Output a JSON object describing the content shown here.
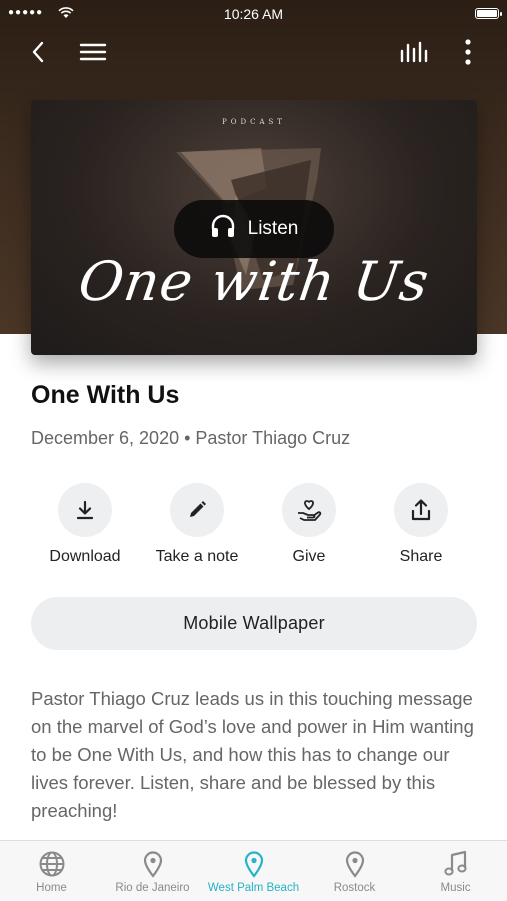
{
  "status_bar": {
    "time": "10:26 AM",
    "signal": "●●●●●"
  },
  "nav": {
    "back_icon": "back-chevron-icon",
    "menu_icon": "hamburger-menu-icon",
    "audio_icon": "audio-bars-icon",
    "more_icon": "more-vertical-icon"
  },
  "cover": {
    "brand": "PODCAST",
    "script_title": "One with Us",
    "listen_label": "Listen"
  },
  "sermon": {
    "title": "One With Us",
    "meta": "December 6, 2020 • Pastor Thiago Cruz"
  },
  "actions": [
    {
      "label": "Download",
      "icon": "download-icon"
    },
    {
      "label": "Take a note",
      "icon": "pencil-icon"
    },
    {
      "label": "Give",
      "icon": "give-heart-hand-icon"
    },
    {
      "label": "Share",
      "icon": "share-icon"
    }
  ],
  "wallpaper_button": "Mobile Wallpaper",
  "description": "Pastor Thiago Cruz leads us in this touching message on the marvel of God’s love and power in Him wanting to be One With Us, and how this has to change our lives forever. Listen, share and be blessed by this preaching!",
  "tabs": [
    {
      "label": "Home",
      "icon": "globe-icon",
      "active": false
    },
    {
      "label": "Rio de Janeiro",
      "icon": "location-pin-icon",
      "active": false
    },
    {
      "label": "West Palm Beach",
      "icon": "location-pin-icon",
      "active": true
    },
    {
      "label": "Rostock",
      "icon": "location-pin-icon",
      "active": false
    },
    {
      "label": "Music",
      "icon": "music-note-icon",
      "active": false
    }
  ],
  "colors": {
    "accent": "#25b3c8",
    "hero_bg": "#3a2a1e"
  }
}
